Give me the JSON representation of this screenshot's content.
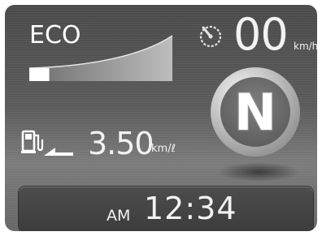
{
  "eco": {
    "label": "ECO",
    "level": 0.14
  },
  "speed": {
    "value": "00",
    "unit": "km/h",
    "icon": "speedometer-icon"
  },
  "gear": {
    "position": "N"
  },
  "fuel_economy": {
    "value": "3.50",
    "unit": "km/ℓ",
    "icon": "fuel-pump-icon"
  },
  "clock": {
    "ampm": "AM",
    "time": "12:34"
  },
  "colors": {
    "text": "#f2f2f2",
    "background": "#5b5b5b",
    "eco_fill": "#ffffff"
  }
}
